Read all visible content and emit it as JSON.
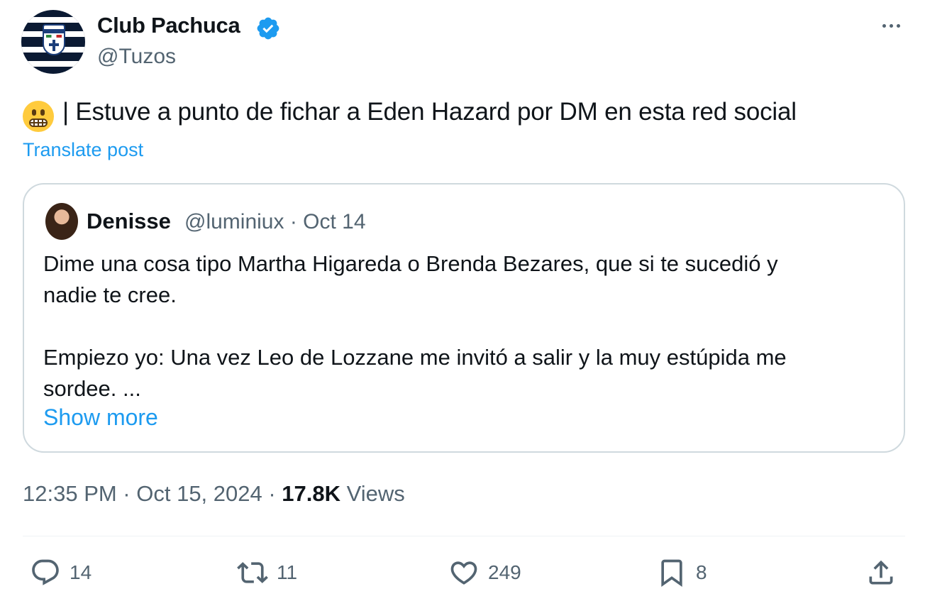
{
  "author": {
    "name": "Club Pachuca",
    "handle": "@Tuzos",
    "verified": true
  },
  "post": {
    "emoji": "grimacing-face-emoji",
    "text": "| Estuve a punto de fichar a Eden Hazard por DM en esta red social",
    "translate_label": "Translate post"
  },
  "quoted": {
    "name": "Denisse",
    "meta": "@luminiux · Oct 14",
    "line1": "Dime una cosa tipo Martha Higareda o Brenda Bezares, que si te sucedió y",
    "line2": "nadie te cree.",
    "line3": "Empiezo yo: Una vez Leo de Lozzane me invitó a salir y la muy estúpida me",
    "line4": "sordee. ...",
    "show_more": "Show more"
  },
  "meta": {
    "timestamp": "12:35 PM · Oct 15, 2024 · ",
    "views_count": "17.8K",
    "views_label": " Views"
  },
  "actions": {
    "replies": "14",
    "reposts": "11",
    "likes": "249",
    "bookmarks": "8"
  },
  "colors": {
    "link": "#1d9bf0",
    "secondary_text": "#536471",
    "border": "#cfd9de"
  }
}
